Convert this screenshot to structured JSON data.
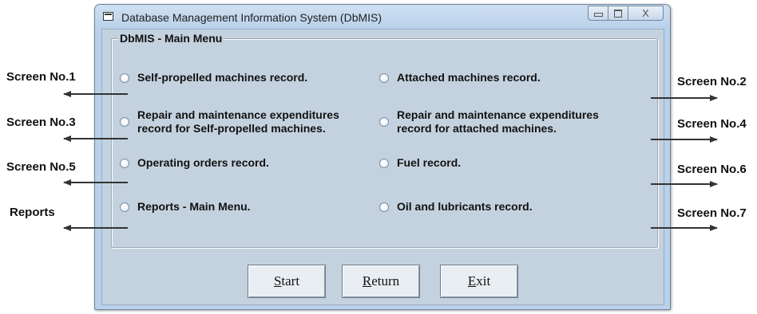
{
  "window": {
    "title": "Database Management Information System (DbMIS)",
    "controls": {
      "close_glyph": "X"
    }
  },
  "group": {
    "title": "DbMIS - Main Menu"
  },
  "options": {
    "left": [
      {
        "lines": [
          "Self-propelled machines record."
        ]
      },
      {
        "lines": [
          "Repair and maintenance expenditures",
          "record for Self-propelled machines."
        ]
      },
      {
        "lines": [
          "Operating orders record."
        ]
      },
      {
        "lines": [
          "Reports - Main Menu."
        ]
      }
    ],
    "right": [
      {
        "lines": [
          "Attached machines record."
        ]
      },
      {
        "lines": [
          "Repair and maintenance expenditures",
          "record for attached machines."
        ]
      },
      {
        "lines": [
          "Fuel record."
        ]
      },
      {
        "lines": [
          "Oil and lubricants record."
        ]
      }
    ]
  },
  "buttons": [
    {
      "hotkey": "S",
      "rest": "tart"
    },
    {
      "hotkey": "R",
      "rest": "eturn"
    },
    {
      "hotkey": "E",
      "rest": "xit"
    }
  ],
  "annotations": {
    "left": [
      "Screen No.1",
      "Screen No.3",
      "Screen No.5",
      "Reports"
    ],
    "right": [
      "Screen No.2",
      "Screen No.4",
      "Screen No.6",
      "Screen No.7"
    ]
  }
}
